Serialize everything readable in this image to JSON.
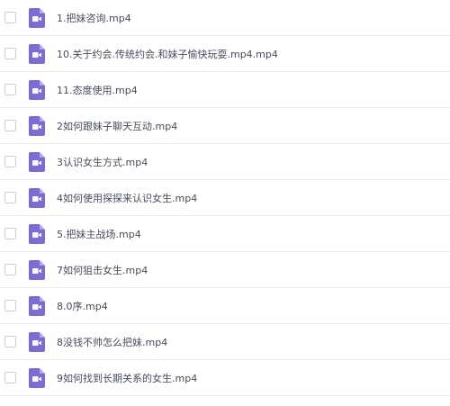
{
  "file_list": {
    "items": [
      {
        "name": "1.把妹咨询.mp4",
        "type_icon": "video-file-icon"
      },
      {
        "name": "10.关于约会.传统约会.和妹子愉快玩耍.mp4.mp4",
        "type_icon": "video-file-icon"
      },
      {
        "name": "11.态度使用.mp4",
        "type_icon": "video-file-icon"
      },
      {
        "name": "2如何跟妹子聊天互动.mp4",
        "type_icon": "video-file-icon"
      },
      {
        "name": "3认识女生方式.mp4",
        "type_icon": "video-file-icon"
      },
      {
        "name": "4如何使用探探来认识女生.mp4",
        "type_icon": "video-file-icon"
      },
      {
        "name": "5.把妹主战场.mp4",
        "type_icon": "video-file-icon"
      },
      {
        "name": "7如何狙击女生.mp4",
        "type_icon": "video-file-icon"
      },
      {
        "name": "8.0序.mp4",
        "type_icon": "video-file-icon"
      },
      {
        "name": "8没钱不帅怎么把妹.mp4",
        "type_icon": "video-file-icon"
      },
      {
        "name": "9如何找到长期关系的女生.mp4",
        "type_icon": "video-file-icon"
      }
    ]
  },
  "colors": {
    "icon_body": "#7b6cd6",
    "icon_fold": "#b2a8ec",
    "icon_glyph": "#ffffff",
    "text": "#454d5a",
    "divider": "#e8ebee",
    "checkbox_border": "#c9cdd3"
  }
}
